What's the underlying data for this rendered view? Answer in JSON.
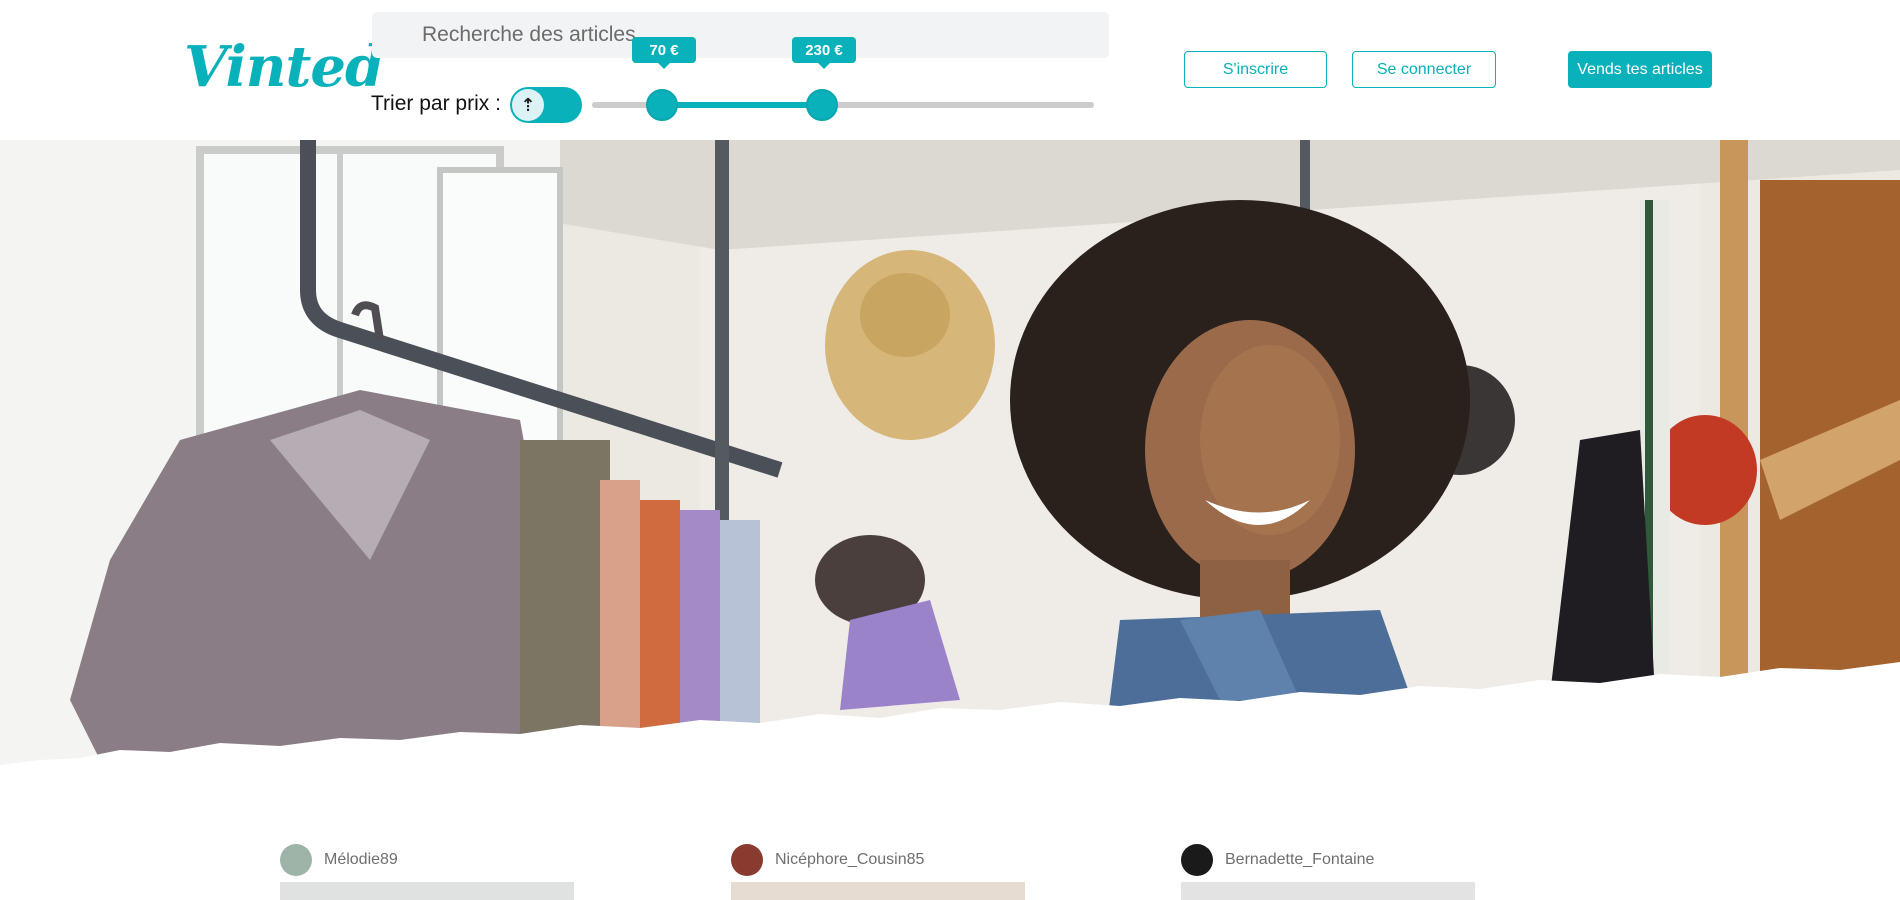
{
  "brand": {
    "logo_text": "Vinted",
    "accent": "#09b1ba"
  },
  "search": {
    "placeholder": "Recherche des articles",
    "icon": "search-icon"
  },
  "sort": {
    "label": "Trier par prix :",
    "toggle_icon": "sort-order-icon",
    "toggle_glyph": "⇡",
    "price_min": 70,
    "price_max": 230,
    "price_min_label": "70 €",
    "price_max_label": "230 €"
  },
  "header_buttons": {
    "signup": "S'inscrire",
    "login": "Se connecter",
    "sell": "Vends tes articles"
  },
  "articles": [
    {
      "username": "Mélodie89"
    },
    {
      "username": "Nicéphore_Cousin85"
    },
    {
      "username": "Bernadette_Fontaine"
    }
  ]
}
